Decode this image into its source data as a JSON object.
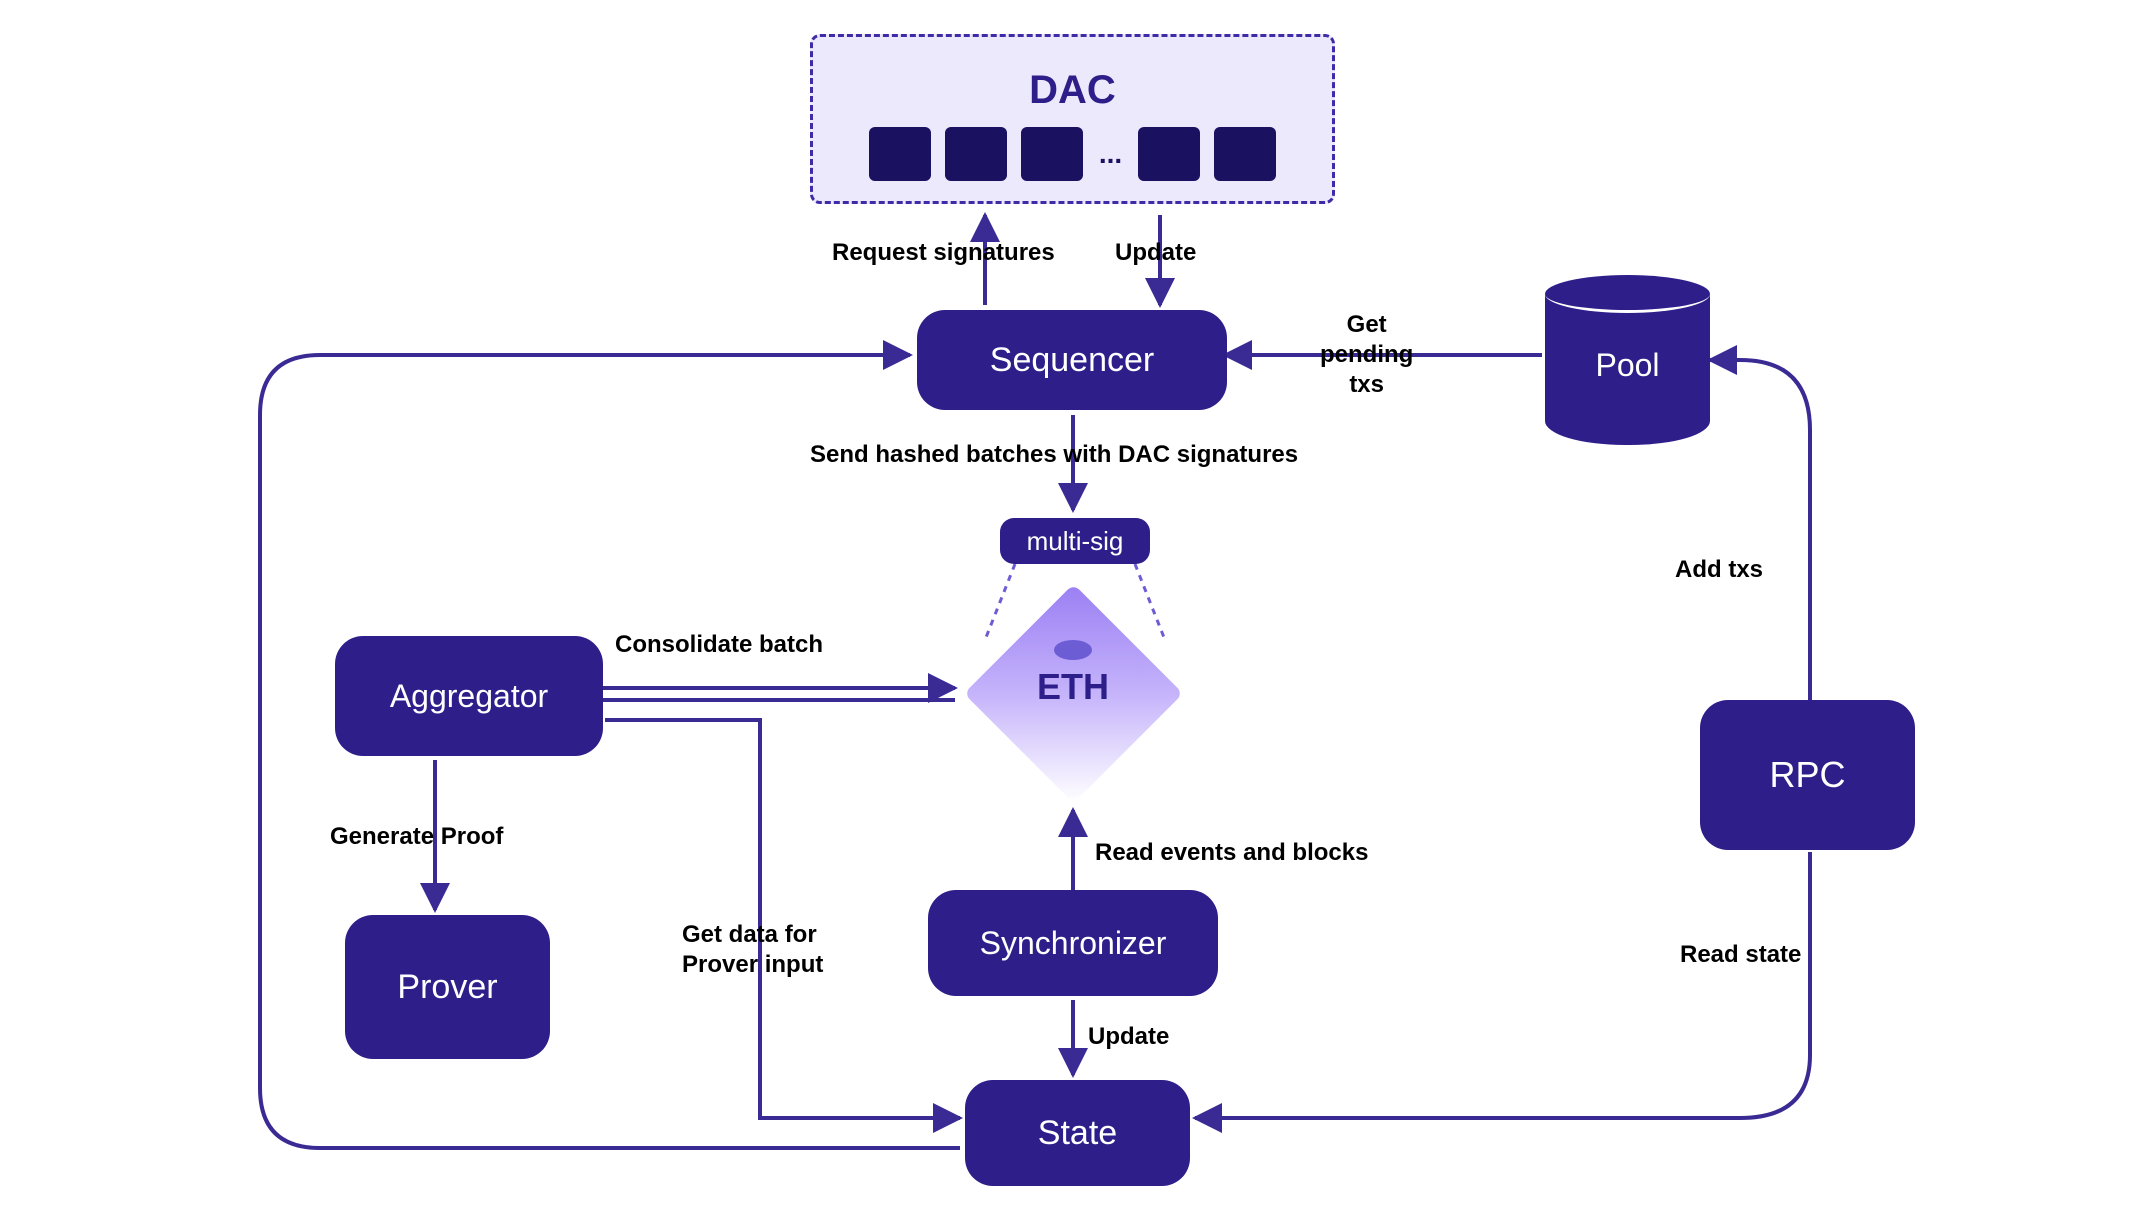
{
  "nodes": {
    "dac": {
      "title": "DAC"
    },
    "sequencer": "Sequencer",
    "pool": "Pool",
    "rpc": "RPC",
    "multisig": "multi-sig",
    "eth": "ETH",
    "aggregator": "Aggregator",
    "prover": "Prover",
    "synchronizer": "Synchronizer",
    "state": "State"
  },
  "edges": {
    "request_signatures": "Request signatures",
    "update_dac": "Update",
    "get_pending_txs": "Get\npending\ntxs",
    "send_hashed": "Send hashed batches with DAC signatures",
    "add_txs": "Add txs",
    "read_state": "Read state",
    "consolidate_batch": "Consolidate batch",
    "generate_proof": "Generate Proof",
    "get_data_prover": "Get data for\nProver input",
    "read_events": "Read events and blocks",
    "update_state": "Update"
  },
  "chart_data": {
    "type": "diagram",
    "title": "",
    "nodes": [
      {
        "id": "dac",
        "label": "DAC",
        "shape": "dashed-box"
      },
      {
        "id": "sequencer",
        "label": "Sequencer",
        "shape": "rounded-box"
      },
      {
        "id": "pool",
        "label": "Pool",
        "shape": "cylinder"
      },
      {
        "id": "rpc",
        "label": "RPC",
        "shape": "rounded-box"
      },
      {
        "id": "multisig",
        "label": "multi-sig",
        "shape": "pill"
      },
      {
        "id": "eth",
        "label": "ETH",
        "shape": "diamond"
      },
      {
        "id": "aggregator",
        "label": "Aggregator",
        "shape": "rounded-box"
      },
      {
        "id": "prover",
        "label": "Prover",
        "shape": "rounded-box"
      },
      {
        "id": "synchronizer",
        "label": "Synchronizer",
        "shape": "rounded-box"
      },
      {
        "id": "state",
        "label": "State",
        "shape": "rounded-box"
      }
    ],
    "edges": [
      {
        "from": "sequencer",
        "to": "dac",
        "label": "Request signatures",
        "direction": "->"
      },
      {
        "from": "dac",
        "to": "sequencer",
        "label": "Update",
        "direction": "->"
      },
      {
        "from": "pool",
        "to": "sequencer",
        "label": "Get pending txs",
        "direction": "->"
      },
      {
        "from": "rpc",
        "to": "pool",
        "label": "Add txs",
        "direction": "->"
      },
      {
        "from": "sequencer",
        "to": "multisig",
        "label": "Send hashed batches with DAC signatures",
        "direction": "->"
      },
      {
        "from": "multisig",
        "to": "eth",
        "label": "",
        "direction": "dashed"
      },
      {
        "from": "aggregator",
        "to": "eth",
        "label": "Consolidate batch",
        "direction": "->"
      },
      {
        "from": "aggregator",
        "to": "prover",
        "label": "Generate Proof",
        "direction": "->"
      },
      {
        "from": "aggregator",
        "to": "state",
        "label": "Get data for Prover input",
        "direction": "->"
      },
      {
        "from": "synchronizer",
        "to": "eth",
        "label": "Read events and blocks",
        "direction": "->"
      },
      {
        "from": "synchronizer",
        "to": "state",
        "label": "Update",
        "direction": "->"
      },
      {
        "from": "state",
        "to": "rpc",
        "label": "Read state",
        "direction": "->"
      },
      {
        "from": "state",
        "to": "sequencer",
        "label": "",
        "direction": "->"
      }
    ]
  }
}
